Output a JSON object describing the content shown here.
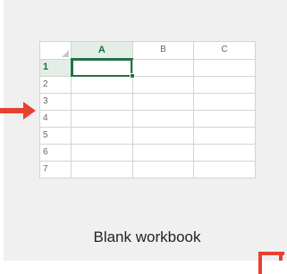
{
  "tile": {
    "caption": "Blank workbook",
    "columns": [
      "A",
      "B",
      "C"
    ],
    "rows": [
      "1",
      "2",
      "3",
      "4",
      "5",
      "6",
      "7"
    ],
    "selected_cell": "A1"
  },
  "colors": {
    "tile_background": "#f0f0f0",
    "accent_green": "#217346",
    "pointer_red": "#e8412f"
  },
  "icons": {
    "left_pointer": "arrow-right-icon",
    "corner_marker": "bracket-icon"
  }
}
